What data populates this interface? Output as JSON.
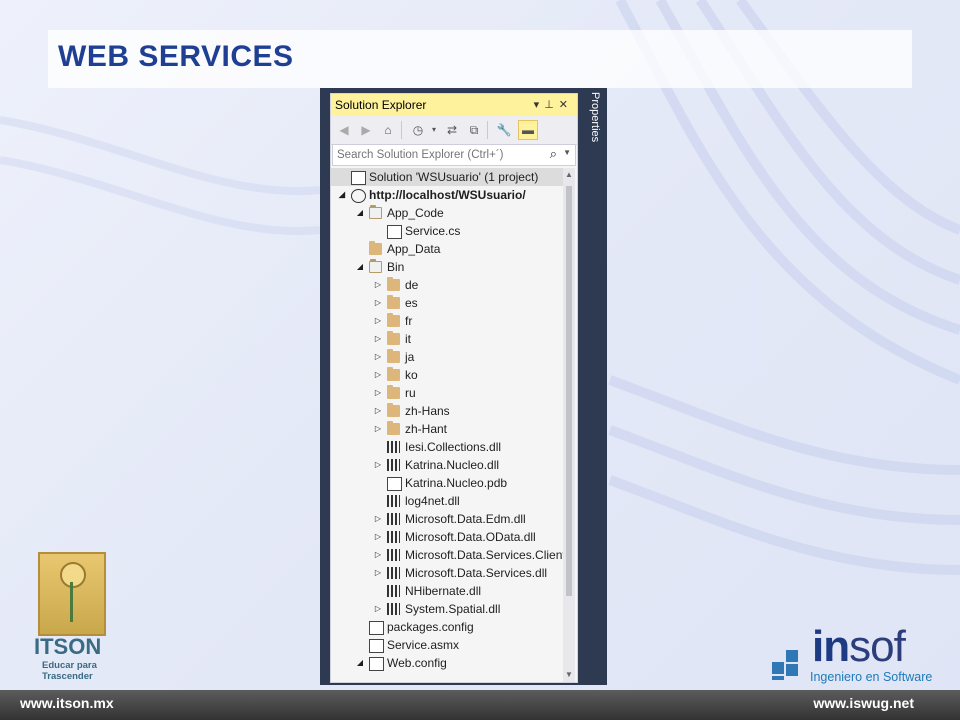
{
  "slide": {
    "title": "WEB SERVICES"
  },
  "solution_explorer": {
    "header": "Solution Explorer",
    "header_controls": [
      "▾",
      "⊥",
      "✕"
    ],
    "search_placeholder": "Search Solution Explorer (Ctrl+´)",
    "properties_tab": "Properties",
    "tree": [
      {
        "label": "Solution 'WSUsuario' (1 project)",
        "icon": "solution-icon",
        "level": 0,
        "arrow": "",
        "selected": true
      },
      {
        "label": "http://localhost/WSUsuario/",
        "icon": "globe-icon",
        "level": 0,
        "arrow": "expanded",
        "bold": true
      },
      {
        "label": "App_Code",
        "icon": "folder-open-icon",
        "level": 1,
        "arrow": "expanded"
      },
      {
        "label": "Service.cs",
        "icon": "cs-file-icon",
        "level": 2,
        "arrow": ""
      },
      {
        "label": "App_Data",
        "icon": "folder-icon",
        "level": 1,
        "arrow": ""
      },
      {
        "label": "Bin",
        "icon": "folder-open-icon",
        "level": 1,
        "arrow": "expanded"
      },
      {
        "label": "de",
        "icon": "folder-icon",
        "level": 2,
        "arrow": "collapsed"
      },
      {
        "label": "es",
        "icon": "folder-icon",
        "level": 2,
        "arrow": "collapsed"
      },
      {
        "label": "fr",
        "icon": "folder-icon",
        "level": 2,
        "arrow": "collapsed"
      },
      {
        "label": "it",
        "icon": "folder-icon",
        "level": 2,
        "arrow": "collapsed"
      },
      {
        "label": "ja",
        "icon": "folder-icon",
        "level": 2,
        "arrow": "collapsed"
      },
      {
        "label": "ko",
        "icon": "folder-icon",
        "level": 2,
        "arrow": "collapsed"
      },
      {
        "label": "ru",
        "icon": "folder-icon",
        "level": 2,
        "arrow": "collapsed"
      },
      {
        "label": "zh-Hans",
        "icon": "folder-icon",
        "level": 2,
        "arrow": "collapsed"
      },
      {
        "label": "zh-Hant",
        "icon": "folder-icon",
        "level": 2,
        "arrow": "collapsed"
      },
      {
        "label": "Iesi.Collections.dll",
        "icon": "dll-icon",
        "level": 2,
        "arrow": ""
      },
      {
        "label": "Katrina.Nucleo.dll",
        "icon": "dll-icon",
        "level": 2,
        "arrow": "collapsed"
      },
      {
        "label": "Katrina.Nucleo.pdb",
        "icon": "pdb-file-icon",
        "level": 2,
        "arrow": ""
      },
      {
        "label": "log4net.dll",
        "icon": "dll-icon",
        "level": 2,
        "arrow": ""
      },
      {
        "label": "Microsoft.Data.Edm.dll",
        "icon": "dll-icon",
        "level": 2,
        "arrow": "collapsed"
      },
      {
        "label": "Microsoft.Data.OData.dll",
        "icon": "dll-icon",
        "level": 2,
        "arrow": "collapsed"
      },
      {
        "label": "Microsoft.Data.Services.Client.dll",
        "icon": "dll-icon",
        "level": 2,
        "arrow": "collapsed"
      },
      {
        "label": "Microsoft.Data.Services.dll",
        "icon": "dll-icon",
        "level": 2,
        "arrow": "collapsed"
      },
      {
        "label": "NHibernate.dll",
        "icon": "dll-icon",
        "level": 2,
        "arrow": ""
      },
      {
        "label": "System.Spatial.dll",
        "icon": "dll-icon",
        "level": 2,
        "arrow": "collapsed"
      },
      {
        "label": "packages.config",
        "icon": "config-file-icon",
        "level": 1,
        "arrow": ""
      },
      {
        "label": "Service.asmx",
        "icon": "asmx-file-icon",
        "level": 1,
        "arrow": ""
      },
      {
        "label": "Web.config",
        "icon": "config-file-icon",
        "level": 1,
        "arrow": "expanded"
      }
    ]
  },
  "footer": {
    "left_url": "www.itson.mx",
    "right_url": "www.iswug.net"
  },
  "itson_logo": {
    "name": "ITSON",
    "tagline_1": "Educar para",
    "tagline_2": "Trascender"
  },
  "insof_logo": {
    "word_in": "in",
    "word_sof": "sof",
    "subtitle": "Ingeniero en Software"
  },
  "colors": {
    "title": "#1f3f93",
    "header_yellow": "#fff29d",
    "frame": "#2d3a52",
    "insof_blue": "#1d3a83"
  }
}
